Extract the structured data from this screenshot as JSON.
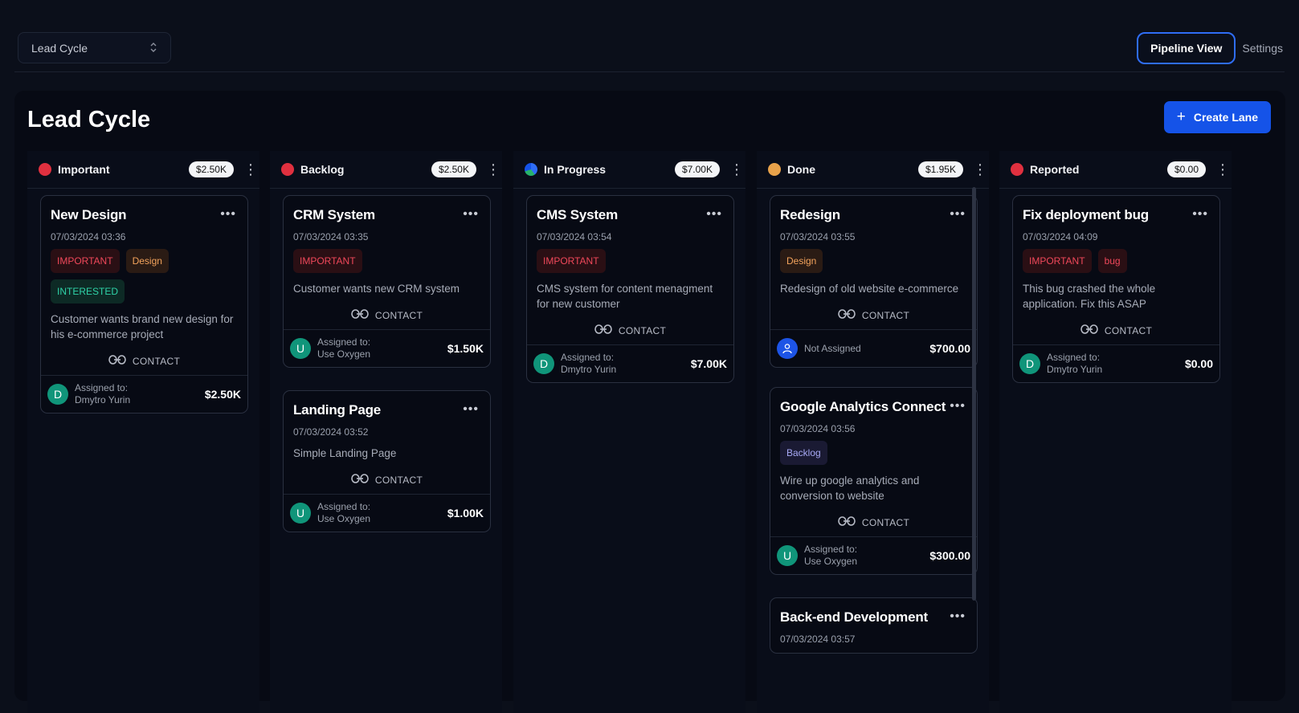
{
  "topbar": {
    "funnel_select": "Lead Cycle",
    "tabs": [
      "Pipeline View",
      "Settings"
    ]
  },
  "board": {
    "title": "Lead Cycle",
    "create_lane": "Create Lane"
  },
  "colors": {
    "accent": "#1553e8",
    "background": "#0b0f1a"
  },
  "lanes": [
    {
      "name": "Important",
      "color": "#e0303f",
      "total": "$2.50K",
      "cards": [
        {
          "title": "New Design",
          "date": "07/03/2024 03:36",
          "tags": [
            {
              "label": "IMPORTANT",
              "kind": "important"
            },
            {
              "label": "Design",
              "kind": "design"
            },
            {
              "label": "INTERESTED",
              "kind": "interested"
            }
          ],
          "desc": "Customer wants brand new design for his e-commerce project",
          "contact": "CONTACT",
          "avatar": "D",
          "assigned_label": "Assigned to:",
          "assignee": "Dmytro Yurin",
          "amount": "$2.50K"
        }
      ]
    },
    {
      "name": "Backlog",
      "color": "#e0303f",
      "total": "$2.50K",
      "cards": [
        {
          "title": "CRM System",
          "date": "07/03/2024 03:35",
          "tags": [
            {
              "label": "IMPORTANT",
              "kind": "important"
            }
          ],
          "desc": "Customer wants new CRM system",
          "contact": "CONTACT",
          "avatar": "U",
          "assigned_label": "Assigned to:",
          "assignee": "Use Oxygen",
          "amount": "$1.50K"
        },
        {
          "title": "Landing Page",
          "date": "07/03/2024 03:52",
          "tags": [],
          "desc": "Simple Landing Page",
          "contact": "CONTACT",
          "avatar": "U",
          "assigned_label": "Assigned to:",
          "assignee": "Use Oxygen",
          "amount": "$1.00K"
        }
      ]
    },
    {
      "name": "In Progress",
      "color": "gradient",
      "total": "$7.00K",
      "cards": [
        {
          "title": "CMS System",
          "date": "07/03/2024 03:54",
          "tags": [
            {
              "label": "IMPORTANT",
              "kind": "important"
            }
          ],
          "desc": "CMS system for content menagment for new customer",
          "contact": "CONTACT",
          "avatar": "D",
          "assigned_label": "Assigned to:",
          "assignee": "Dmytro Yurin",
          "amount": "$7.00K"
        }
      ]
    },
    {
      "name": "Done",
      "color": "#e8a24a",
      "total": "$1.95K",
      "cards": [
        {
          "title": "Redesign",
          "date": "07/03/2024 03:55",
          "tags": [
            {
              "label": "Design",
              "kind": "design"
            }
          ],
          "desc": "Redesign of old website e-commerce",
          "contact": "CONTACT",
          "avatar": "person",
          "assigned_label": "",
          "assignee": "Not Assigned",
          "amount": "$700.00"
        },
        {
          "title": "Google Analytics Connect",
          "date": "07/03/2024 03:56",
          "tags": [
            {
              "label": "Backlog",
              "kind": "backlog"
            }
          ],
          "desc": "Wire up google analytics and conversion to website",
          "contact": "CONTACT",
          "avatar": "U",
          "assigned_label": "Assigned to:",
          "assignee": "Use Oxygen",
          "amount": "$300.00"
        },
        {
          "title": "Back-end Development",
          "date": "07/03/2024 03:57",
          "tags": [],
          "desc": "",
          "contact": "",
          "avatar": "",
          "assigned_label": "",
          "assignee": "",
          "amount": ""
        }
      ]
    },
    {
      "name": "Reported",
      "color": "#e0303f",
      "total": "$0.00",
      "cards": [
        {
          "title": "Fix deployment bug",
          "date": "07/03/2024 04:09",
          "tags": [
            {
              "label": "IMPORTANT",
              "kind": "important"
            },
            {
              "label": "bug",
              "kind": "bug"
            }
          ],
          "desc": "This bug crashed the whole application. Fix this ASAP",
          "contact": "CONTACT",
          "avatar": "D",
          "assigned_label": "Assigned to:",
          "assignee": "Dmytro Yurin",
          "amount": "$0.00"
        }
      ]
    }
  ]
}
